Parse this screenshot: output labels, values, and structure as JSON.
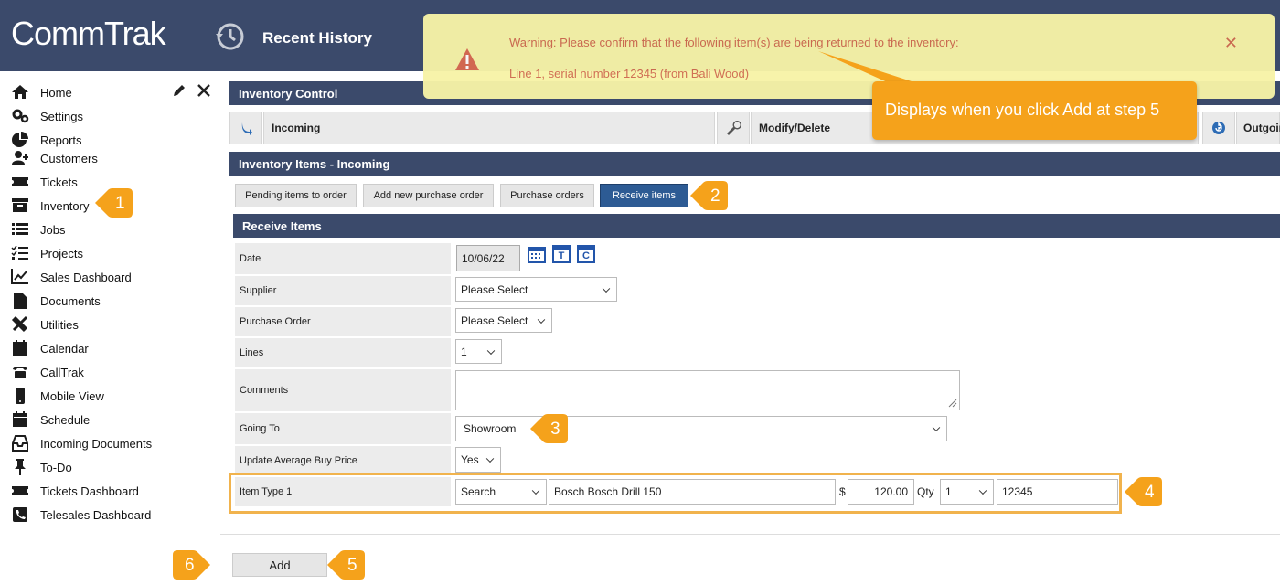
{
  "app": {
    "logo": "CommTrak",
    "history_label": "Recent History"
  },
  "warning": {
    "line1": "Warning: Please confirm that the following item(s) are being returned to the inventory:",
    "line2": "Line 1, serial number 12345 (from Bali Wood)",
    "close": "✕"
  },
  "note": "Displays when you click Add at step 5",
  "sidebar": {
    "items": [
      {
        "label": "Home",
        "icon": "home-icon"
      },
      {
        "label": "Settings",
        "icon": "gears-icon"
      },
      {
        "label": "Reports",
        "icon": "pie-chart-icon"
      },
      {
        "label": "Customers",
        "icon": "user-plus-icon"
      },
      {
        "label": "Tickets",
        "icon": "ticket-icon"
      },
      {
        "label": "Inventory",
        "icon": "archive-icon"
      },
      {
        "label": "Jobs",
        "icon": "list-icon"
      },
      {
        "label": "Projects",
        "icon": "checklist-icon"
      },
      {
        "label": "Sales Dashboard",
        "icon": "line-chart-icon"
      },
      {
        "label": "Documents",
        "icon": "file-icon"
      },
      {
        "label": "Utilities",
        "icon": "tools-icon"
      },
      {
        "label": "Calendar",
        "icon": "calendar-icon"
      },
      {
        "label": "CallTrak",
        "icon": "phone-icon"
      },
      {
        "label": "Mobile View",
        "icon": "mobile-icon"
      },
      {
        "label": "Schedule",
        "icon": "calendar-icon"
      },
      {
        "label": "Incoming Documents",
        "icon": "inbox-icon"
      },
      {
        "label": "To-Do",
        "icon": "pin-icon"
      },
      {
        "label": "Tickets Dashboard",
        "icon": "ticket-icon"
      },
      {
        "label": "Telesales Dashboard",
        "icon": "phone-square-icon"
      }
    ]
  },
  "inventory_control": {
    "title": "Inventory Control",
    "tabs": [
      "Incoming",
      "Modify/Delete",
      "Outgoing"
    ]
  },
  "items_incoming": {
    "title": "Inventory Items - Incoming"
  },
  "buttons": [
    "Pending items to order",
    "Add new purchase order",
    "Purchase orders",
    "Receive items"
  ],
  "receive": {
    "title": "Receive Items",
    "date_label": "Date",
    "date_value": "10/06/22",
    "date_icons": [
      "T",
      "C"
    ],
    "supplier_label": "Supplier",
    "supplier_value": "Please Select",
    "po_label": "Purchase Order",
    "po_value": "Please Select",
    "lines_label": "Lines",
    "lines_value": "1",
    "comments_label": "Comments",
    "going_label": "Going To",
    "going_value": "Showroom",
    "avg_label": "Update Average Buy Price",
    "avg_value": "Yes",
    "item_label": "Item Type 1",
    "item_search": "Search",
    "item_name": "Bosch Bosch Drill 150",
    "currency": "$",
    "price": "120.00",
    "qty_label": "Qty",
    "qty_value": "1",
    "serial": "12345"
  },
  "add_label": "Add",
  "callouts": [
    "1",
    "2",
    "3",
    "4",
    "5",
    "6"
  ],
  "colors": {
    "header": "#3b4a6b",
    "accent": "#f5a21b",
    "active_btn": "#2d5b94",
    "warning_bg": "#f7f3a7"
  }
}
